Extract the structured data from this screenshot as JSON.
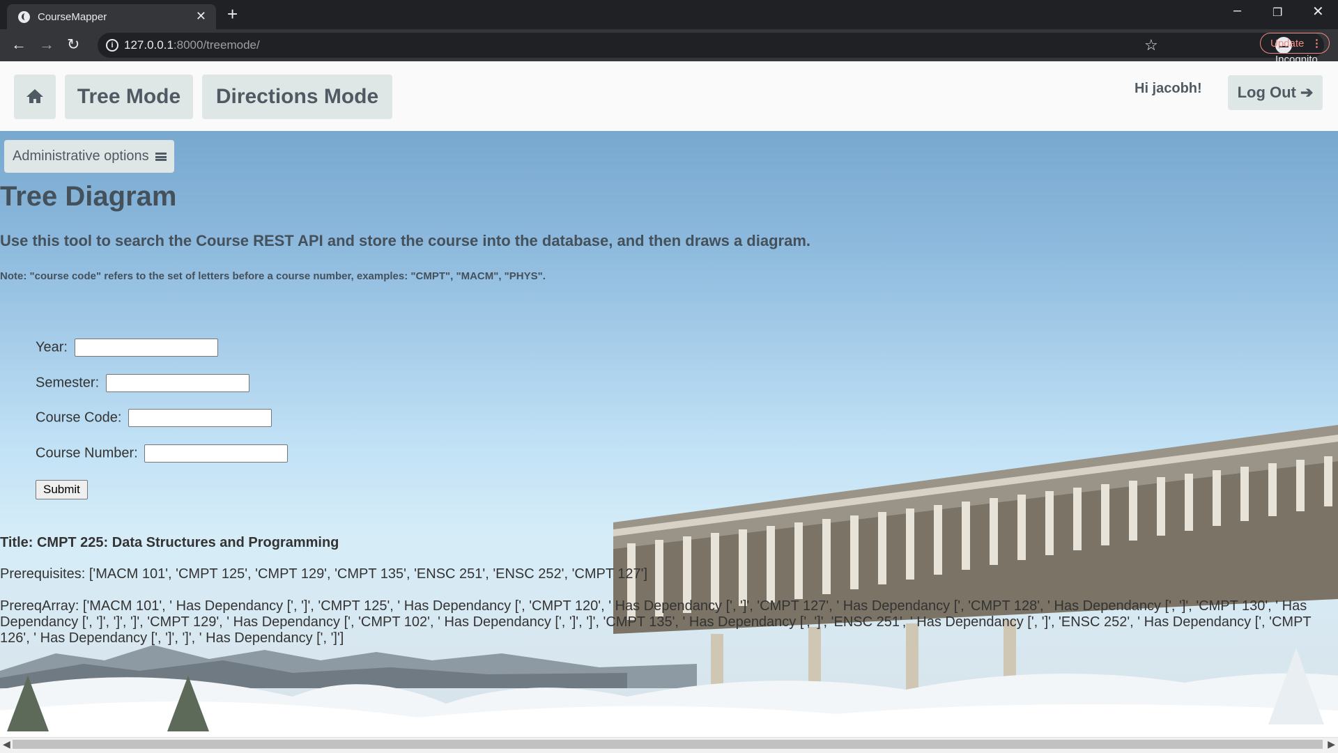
{
  "browser": {
    "tab_title": "CourseMapper",
    "tab_close": "✕",
    "new_tab": "+",
    "url_host": "127.0.0.1",
    "url_rest": ":8000/treemode/",
    "incognito_label": "Incognito",
    "update_label": "Update"
  },
  "navbar": {
    "tree_mode": "Tree Mode",
    "directions_mode": "Directions Mode",
    "greeting": "Hi jacobh!",
    "logout": "Log Out ➔"
  },
  "admin_options": "Administrative options",
  "content": {
    "title": "Tree Diagram",
    "lead": "Use this tool to search the Course REST API and store the course into the database, and then draws a diagram.",
    "note": "Note: \"course code\" refers to the set of letters before a course number, examples: \"CMPT\", \"MACM\", \"PHYS\"."
  },
  "form": {
    "year_label": "Year:",
    "year_value": "",
    "semester_label": "Semester:",
    "semester_value": "",
    "course_code_label": "Course Code:",
    "course_code_value": "",
    "course_number_label": "Course Number:",
    "course_number_value": "",
    "submit_label": "Submit"
  },
  "result": {
    "title": "Title: CMPT 225: Data Structures and Programming",
    "prerequisites": "Prerequisites: ['MACM 101', 'CMPT 125', 'CMPT 129', 'CMPT 135', 'ENSC 251', 'ENSC 252', 'CMPT 127']",
    "prereq_array": "PrereqArray: ['MACM 101', ' Has Dependancy [', ']', 'CMPT 125', ' Has Dependancy [', 'CMPT 120', ' Has Dependancy [', ']', 'CMPT 127', ' Has Dependancy [', 'CMPT 128', ' Has Dependancy [', ']', 'CMPT 130', ' Has Dependancy [', ']', ']', ']', 'CMPT 129', ' Has Dependancy [', 'CMPT 102', ' Has Dependancy [', ']', ']', 'CMPT 135', ' Has Dependancy [', ']', 'ENSC 251', ' Has Dependancy [', ']', 'ENSC 252', ' Has Dependancy [', 'CMPT 126', ' Has Dependancy [', ']', ']', ' Has Dependancy [', ']']"
  },
  "icons": {
    "home": "home-icon",
    "menu": "hamburger-icon",
    "arrow": "arrow-right-icon"
  }
}
